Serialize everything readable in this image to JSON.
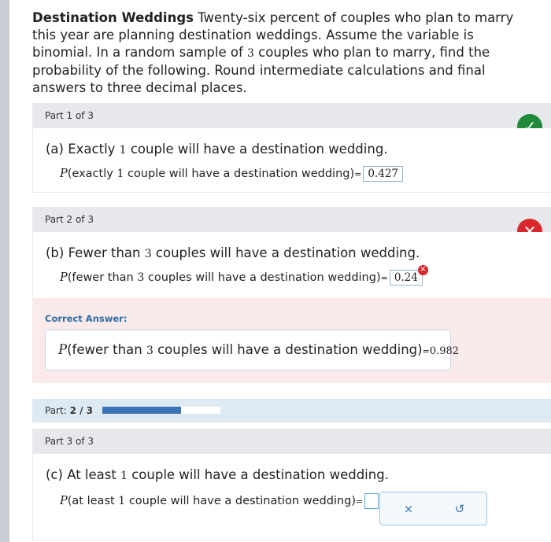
{
  "question": {
    "title": "Destination Weddings",
    "text_1": " Twenty-six percent of couples who plan to marry this year are planning destination weddings. Assume the variable is binomial. In a random sample of ",
    "n": "3",
    "text_2": " couples who plan to marry, find the probability of the following. Round intermediate calculations and final answers to three decimal places."
  },
  "parts": [
    {
      "header": "Part 1 of 3",
      "prompt_pre": "(a) Exactly ",
      "prompt_num": "1",
      "prompt_post": " couple will have a destination wedding.",
      "p_symbol": "P",
      "ans_pre": "(exactly ",
      "ans_num": "1",
      "ans_post": " couple will have a destination wedding)",
      "equals": "=",
      "value": "0.427",
      "status": "correct",
      "status_icon": "check-icon"
    },
    {
      "header": "Part 2 of 3",
      "prompt_pre": "(b) Fewer than ",
      "prompt_num": "3",
      "prompt_post": " couples will have a destination wedding.",
      "p_symbol": "P",
      "ans_pre": "(fewer than ",
      "ans_num": "3",
      "ans_post": " couples will have a destination wedding)",
      "equals": "=",
      "value": "0.24",
      "status": "incorrect",
      "status_icon": "x-icon",
      "correct_label": "Correct Answer:",
      "correct_p": "P",
      "correct_pre": "(fewer than ",
      "correct_num": "3",
      "correct_post": " couples will have a destination wedding)",
      "correct_equals": "=",
      "correct_value": "0.982"
    },
    {
      "header": "Part 3 of 3",
      "prompt_pre": "(c) At least ",
      "prompt_num": "1",
      "prompt_post": " couple will have a destination wedding.",
      "p_symbol": "P",
      "ans_pre": "(at least ",
      "ans_num": "1",
      "ans_post": " couple will have a destination wedding)",
      "equals": "=",
      "value": ""
    }
  ],
  "progress": {
    "label": "Part:",
    "value": "2 / 3",
    "fraction": 0.667
  },
  "tools": {
    "clear": "×",
    "undo": "↺"
  },
  "colors": {
    "correct": "#1e8a3a",
    "incorrect": "#d9272e",
    "accent": "#3a74b4"
  }
}
